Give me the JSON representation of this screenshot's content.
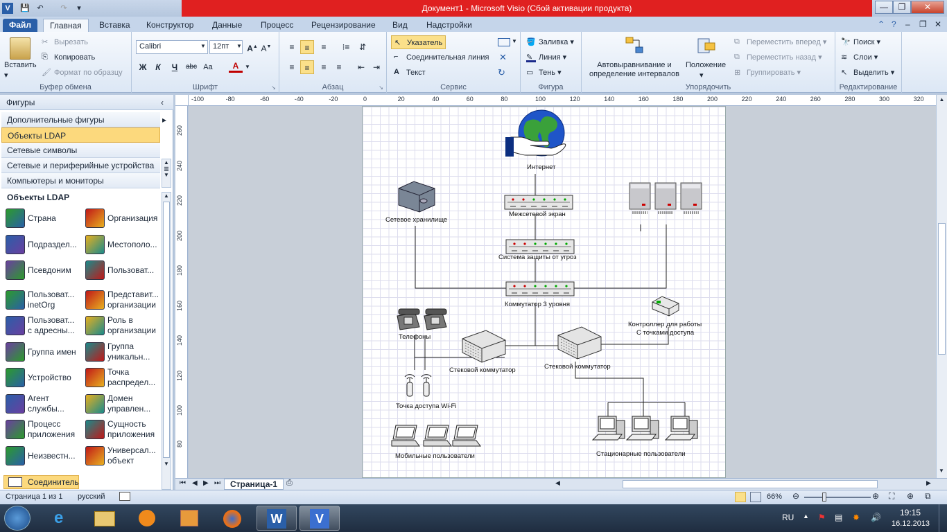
{
  "window": {
    "title": "Документ1  -  Microsoft Visio (Сбой активации продукта)",
    "app_icon": "V",
    "controls": [
      "—",
      "❐",
      "✕"
    ]
  },
  "tabs": [
    "Файл",
    "Главная",
    "Вставка",
    "Конструктор",
    "Данные",
    "Процесс",
    "Рецензирование",
    "Вид",
    "Надстройки"
  ],
  "active_tab": "Главная",
  "ribbon": {
    "clipboard": {
      "paste": "Вставить",
      "cut": "Вырезать",
      "copy": "Копировать",
      "format": "Формат по образцу",
      "label": "Буфер обмена"
    },
    "font": {
      "name": "Calibri",
      "size": "12пт",
      "label": "Шрифт",
      "bold": "Ж",
      "italic": "К",
      "underline": "Ч",
      "strike": "abc",
      "case": "Aa",
      "color": "A"
    },
    "paragraph": {
      "label": "Абзац"
    },
    "tools": {
      "pointer": "Указатель",
      "connector": "Соединительная линия",
      "text": "Текст",
      "label": "Сервис"
    },
    "shape": {
      "fill": "Заливка",
      "line": "Линия",
      "shadow": "Тень",
      "label": "Фигура"
    },
    "arrange": {
      "autoalign": "Автовыравнивание и определение интервалов",
      "position": "Положение",
      "forward": "Переместить вперед",
      "backward": "Переместить назад",
      "group": "Группировать",
      "label": "Упорядочить"
    },
    "editing": {
      "find": "Поиск",
      "layers": "Слои",
      "select": "Выделить",
      "label": "Редактирование"
    }
  },
  "shapes_panel": {
    "header": "Фигуры",
    "stencils": [
      "Дополнительные фигуры",
      "Объекты LDAP",
      "Сетевые символы",
      "Сетевые и периферийные устройства",
      "Компьютеры и мониторы"
    ],
    "selected_stencil": "Объекты LDAP",
    "section": "Объекты LDAP",
    "masters": [
      [
        "Страна"
      ],
      [
        "Организация"
      ],
      [
        "Подраздел..."
      ],
      [
        "Местополо..."
      ],
      [
        "Псевдоним"
      ],
      [
        "Пользоват..."
      ],
      [
        "Пользоват...",
        "inetOrg"
      ],
      [
        "Представит...",
        "организации"
      ],
      [
        "Пользоват...",
        "с адресны..."
      ],
      [
        "Роль в",
        "организации"
      ],
      [
        "Группа имен"
      ],
      [
        "Группа",
        "уникальн..."
      ],
      [
        "Устройство"
      ],
      [
        "Точка",
        "распредел..."
      ],
      [
        "Агент",
        "службы..."
      ],
      [
        "Домен",
        "управлен..."
      ],
      [
        "Процесс",
        "приложения"
      ],
      [
        "Сущность",
        "приложения"
      ],
      [
        "Неизвестн..."
      ],
      [
        "Универсал...",
        "объект"
      ]
    ],
    "connector": "Соединитель"
  },
  "ruler": {
    "h": [
      "-100",
      "-80",
      "-60",
      "-40",
      "-20",
      "0",
      "20",
      "40",
      "60",
      "80",
      "100",
      "120",
      "140",
      "160",
      "180",
      "200",
      "220",
      "240",
      "260",
      "280",
      "300",
      "320"
    ],
    "v": [
      "260",
      "240",
      "220",
      "200",
      "180",
      "160",
      "140",
      "120",
      "100",
      "80"
    ]
  },
  "diagram": {
    "internet": "Интернет",
    "firewall": "Межсетевой экран",
    "ips": "Система защиты от угроз",
    "l3switch": "Коммутатор 3 уровня",
    "storage": "Сетевое хранилище",
    "phones": "Телефоны",
    "wifi": "Точка доступа Wi-Fi",
    "stack1": "Стековой коммутатор",
    "stack2": "Стековой коммутатор",
    "controller1": "Контроллер для работы",
    "controller2": "С точками доступа",
    "mobile": "Мобильные пользователи",
    "desktop": "Стационарные пользователи"
  },
  "page_tab": "Страница-1",
  "status": {
    "page": "Страница 1 из 1",
    "lang": "русский",
    "zoom": "66%"
  },
  "taskbar": {
    "lang": "RU",
    "time": "19:15",
    "date": "16.12.2013"
  }
}
